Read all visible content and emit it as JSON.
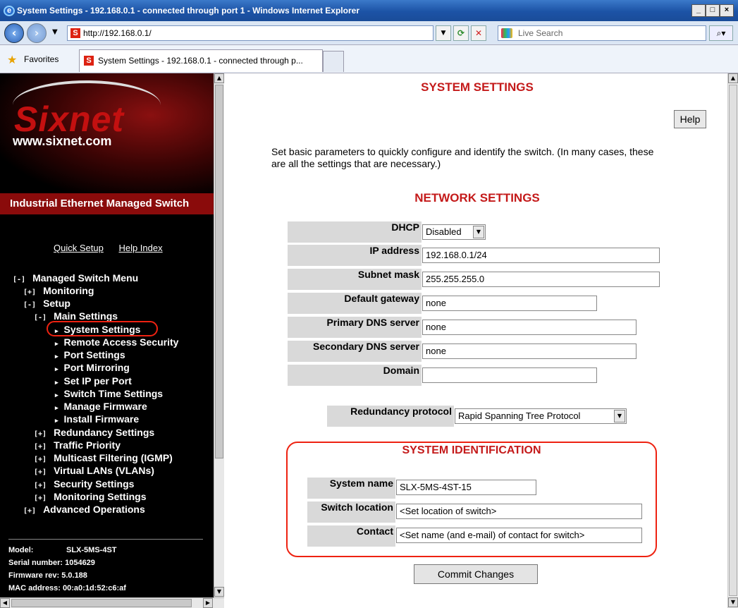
{
  "window": {
    "title": "System Settings - 192.168.0.1 - connected through port 1 - Windows Internet Explorer",
    "controls": [
      "_",
      "□",
      "×"
    ]
  },
  "addressbar": {
    "url": "http://192.168.0.1/",
    "search_placeholder": "Live Search"
  },
  "favorites": {
    "label": "Favorites",
    "tab_title": "System Settings - 192.168.0.1 - connected through p..."
  },
  "sidebar": {
    "brand": "Sixnet",
    "website": "www.sixnet.com",
    "product": "Industrial Ethernet Managed Switch",
    "quick_setup": "Quick Setup",
    "help_index": "Help Index",
    "menu": [
      {
        "toggle": "[-]",
        "label": "Managed Switch Menu",
        "selected": false
      },
      {
        "toggle": "[+]",
        "label": "Monitoring",
        "selected": false
      },
      {
        "toggle": "[-]",
        "label": "Setup",
        "selected": false
      },
      {
        "toggle": "[-]",
        "label": "Main Settings",
        "selected": false
      },
      {
        "toggle": "",
        "label": "System Settings",
        "selected": true
      },
      {
        "toggle": "",
        "label": "Remote Access Security",
        "selected": false
      },
      {
        "toggle": "",
        "label": "Port Settings",
        "selected": false
      },
      {
        "toggle": "",
        "label": "Port Mirroring",
        "selected": false
      },
      {
        "toggle": "",
        "label": "Set IP per Port",
        "selected": false
      },
      {
        "toggle": "",
        "label": "Switch Time Settings",
        "selected": false
      },
      {
        "toggle": "",
        "label": "Manage Firmware",
        "selected": false
      },
      {
        "toggle": "",
        "label": "Install Firmware",
        "selected": false
      },
      {
        "toggle": "[+]",
        "label": "Redundancy Settings",
        "selected": false
      },
      {
        "toggle": "[+]",
        "label": "Traffic Priority",
        "selected": false
      },
      {
        "toggle": "[+]",
        "label": "Multicast Filtering (IGMP)",
        "selected": false
      },
      {
        "toggle": "[+]",
        "label": "Virtual LANs (VLANs)",
        "selected": false
      },
      {
        "toggle": "[+]",
        "label": "Security Settings",
        "selected": false
      },
      {
        "toggle": "[+]",
        "label": "Monitoring Settings",
        "selected": false
      },
      {
        "toggle": "[+]",
        "label": "Advanced Operations",
        "selected": false
      }
    ],
    "info": [
      {
        "label": "Model:",
        "value": "SLX-5MS-4ST"
      },
      {
        "label": "Serial number:",
        "value": "1054629"
      },
      {
        "label": "Firmware rev:",
        "value": "5.0.188"
      },
      {
        "label": "MAC address:",
        "value": "00:a0:1d:52:c6:af"
      }
    ]
  },
  "main": {
    "title": "SYSTEM SETTINGS",
    "help": "Help",
    "intro": "Set basic parameters to quickly configure and identify the switch. (In many cases, these are all the settings that are necessary.)",
    "network_title": "NETWORK SETTINGS",
    "network": [
      {
        "label": "DHCP",
        "value": "Disabled",
        "type": "select"
      },
      {
        "label": "IP address",
        "value": "192.168.0.1/24",
        "type": "text"
      },
      {
        "label": "Subnet mask",
        "value": "255.255.255.0",
        "type": "text"
      },
      {
        "label": "Default gateway",
        "value": "none",
        "type": "text"
      },
      {
        "label": "Primary DNS server",
        "value": "none",
        "type": "text"
      },
      {
        "label": "Secondary DNS server",
        "value": "none",
        "type": "text"
      },
      {
        "label": "Domain",
        "value": "",
        "type": "text"
      }
    ],
    "redundancy_label": "Redundancy protocol",
    "redundancy_value": "Rapid Spanning Tree Protocol",
    "sysid_title": "SYSTEM IDENTIFICATION",
    "sysid": [
      {
        "label": "System name",
        "value": "SLX-5MS-4ST-15"
      },
      {
        "label": "Switch location",
        "value": "<Set location of switch>"
      },
      {
        "label": "Contact",
        "value": "<Set name (and e-mail) of contact for switch>"
      }
    ],
    "commit": "Commit Changes"
  }
}
